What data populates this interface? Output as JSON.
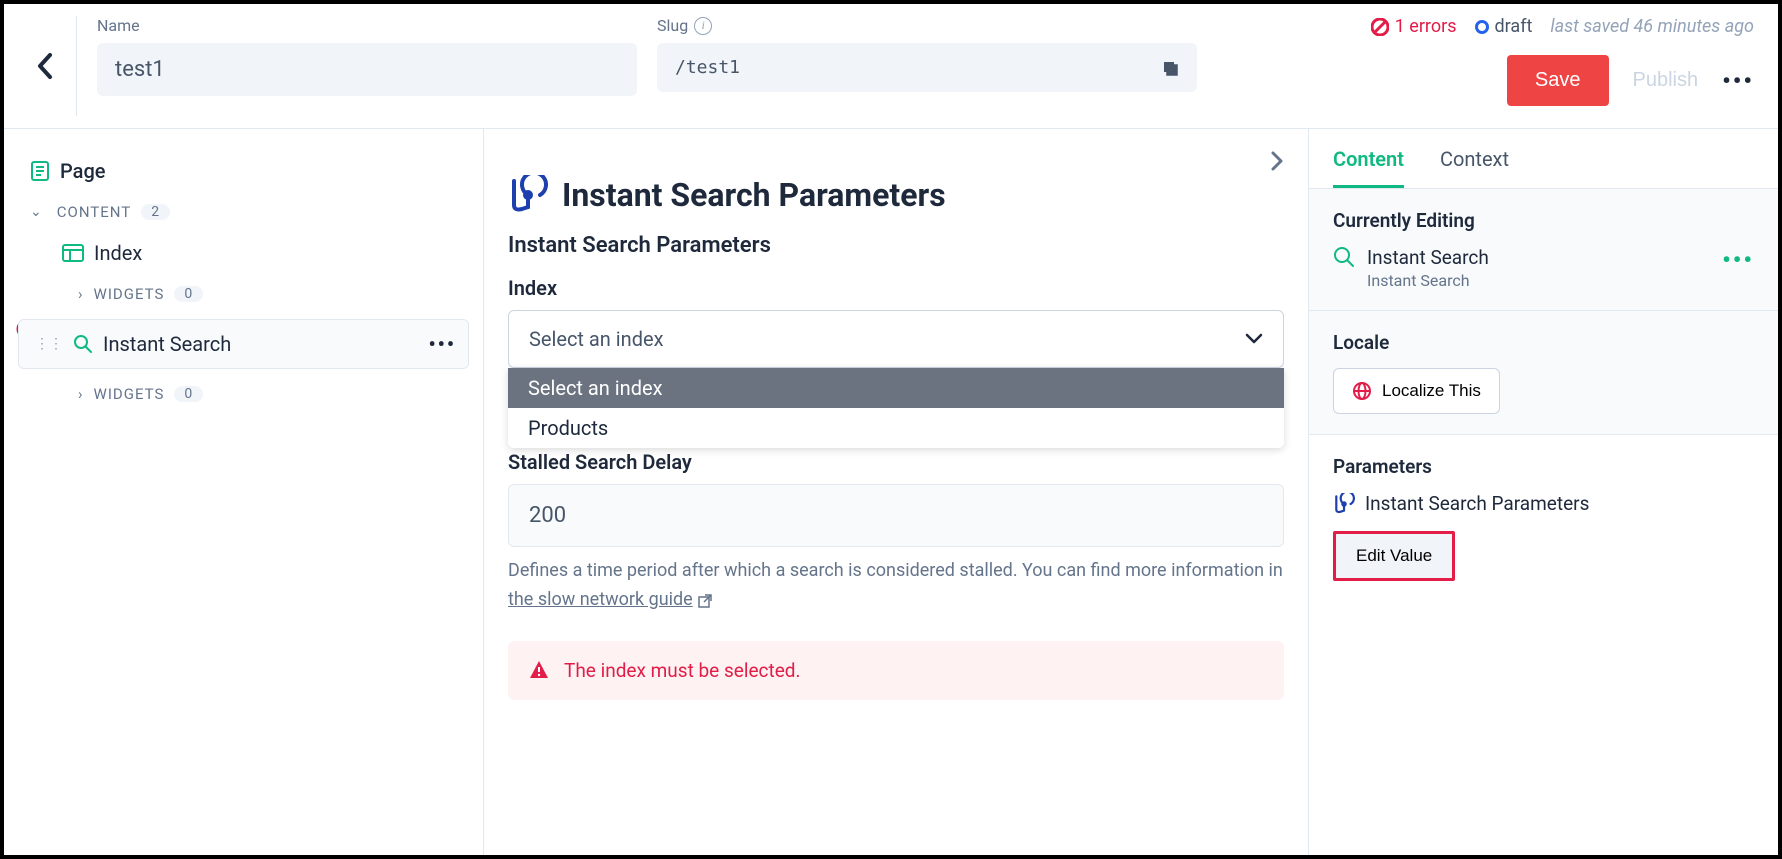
{
  "status": {
    "errors_label": "1 errors",
    "draft_label": "draft",
    "saved_label": "last saved 46 minutes ago"
  },
  "header": {
    "name_label": "Name",
    "name_value": "test1",
    "slug_label": "Slug",
    "slug_value": "/test1",
    "save_label": "Save",
    "publish_label": "Publish"
  },
  "sidebar": {
    "page_label": "Page",
    "content_label": "CONTENT",
    "content_count": "2",
    "index_label": "Index",
    "widgets_label": "WIDGETS",
    "widgets_count_1": "0",
    "instant_search_label": "Instant Search",
    "widgets_count_2": "0"
  },
  "main": {
    "title": "Instant Search Parameters",
    "subtitle": "Instant Search Parameters",
    "index_label": "Index",
    "index_placeholder": "Select an index",
    "dropdown": {
      "opt1": "Select an index",
      "opt2": "Products"
    },
    "stalled_label": "Stalled Search Delay",
    "stalled_value": "200",
    "help_prefix": "Defines a time period after which a search is considered stalled. You can find more information in",
    "help_link": "the slow network guide",
    "error_text": "The index must be selected."
  },
  "rightpanel": {
    "tab_content": "Content",
    "tab_context": "Context",
    "currently_editing_heading": "Currently Editing",
    "editing_title": "Instant Search",
    "editing_sub": "Instant Search",
    "locale_heading": "Locale",
    "localize_label": "Localize This",
    "parameters_heading": "Parameters",
    "param_item": "Instant Search Parameters",
    "edit_value_label": "Edit Value"
  }
}
